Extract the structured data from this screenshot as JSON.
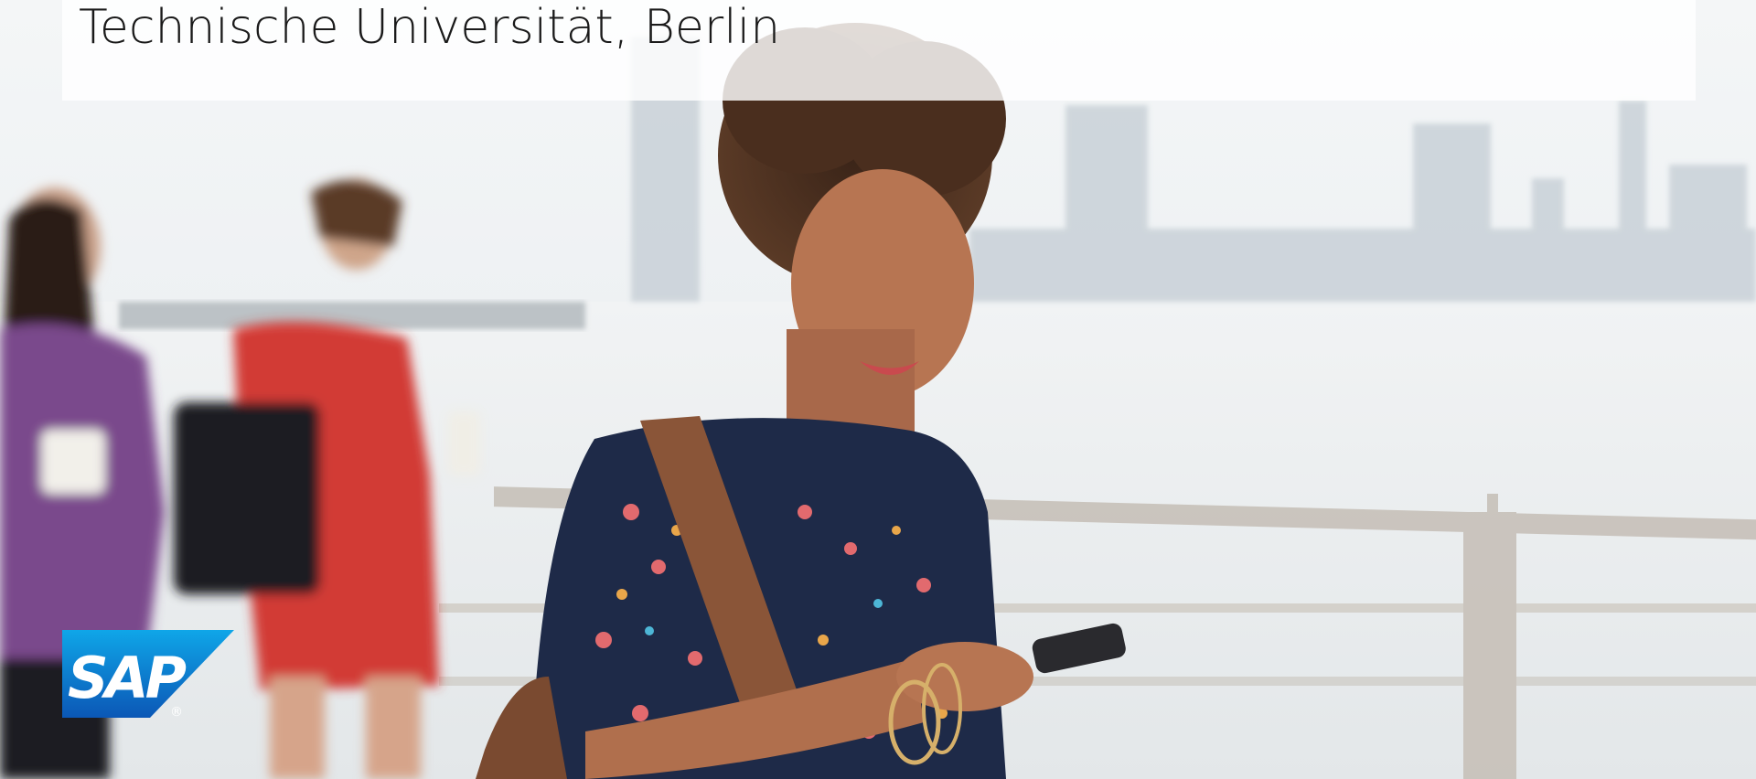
{
  "header": {
    "title": "Technische Universität, Berlin"
  },
  "logo": {
    "text": "SAP",
    "registered_mark": "®"
  },
  "colors": {
    "logo_blue_light": "#0fa6e8",
    "logo_blue_dark": "#0b57b6",
    "title_text": "#1a1a1a",
    "title_band": "#ffffff"
  }
}
